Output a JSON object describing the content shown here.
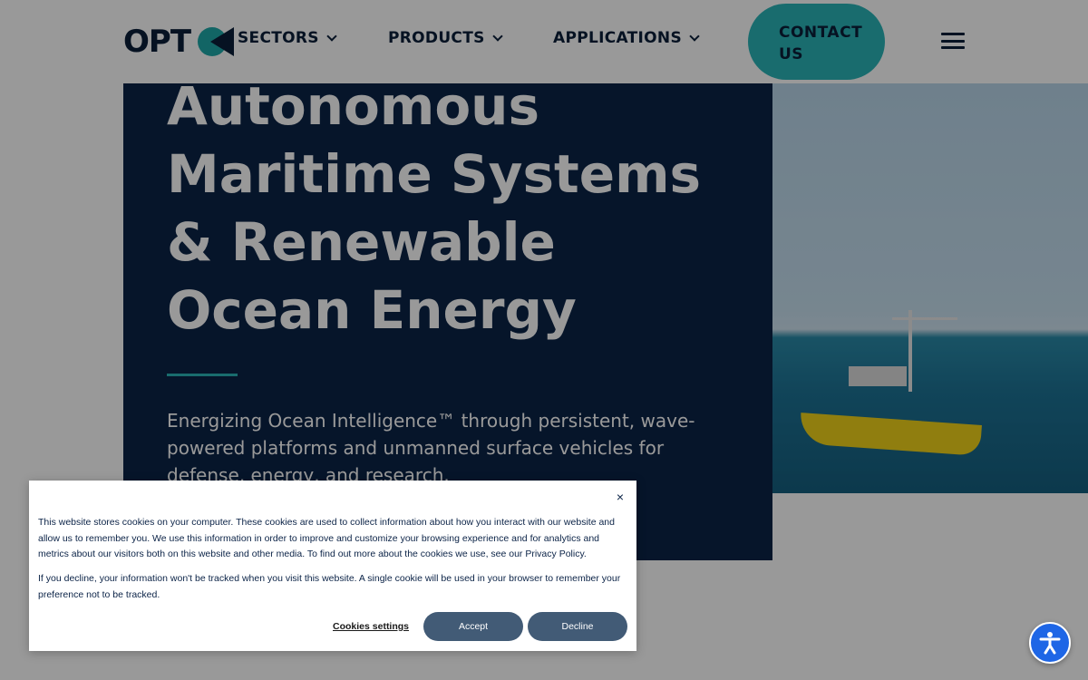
{
  "header": {
    "logo_text": "OPT",
    "nav": [
      {
        "label": "SECTORS"
      },
      {
        "label": "PRODUCTS"
      },
      {
        "label": "APPLICATIONS"
      }
    ],
    "contact_label_line1": "CONTACT",
    "contact_label_line2": "US"
  },
  "hero": {
    "title": "Autonomous Maritime Systems & Renewable Ocean Energy",
    "subtitle": "Energizing Ocean Intelligence™ through persistent, wave-powered platforms and unmanned surface vehicles for defense, energy, and research."
  },
  "cookie_banner": {
    "close_symbol": "×",
    "paragraph1": "This website stores cookies on your computer. These cookies are used to collect information about how you interact with our website and allow us to remember you. We use this information in order to improve and customize your browsing experience and for analytics and metrics about our visitors both on this website and other media. To find out more about the cookies we use, see our Privacy Policy.",
    "paragraph2": "If you decline, your information won't be tracked when you visit this website. A single cookie will be used in your browser to remember your preference not to be tracked.",
    "settings_label": "Cookies settings",
    "accept_label": "Accept",
    "decline_label": "Decline"
  },
  "colors": {
    "navy": "#0b2347",
    "teal": "#2bb5b8",
    "cookie_button": "#425b76",
    "a11y_blue": "#1e66e6"
  },
  "icons": {
    "menu": "hamburger-icon",
    "chevron": "chevron-down-icon",
    "accessibility": "accessibility-icon",
    "close": "close-icon"
  }
}
